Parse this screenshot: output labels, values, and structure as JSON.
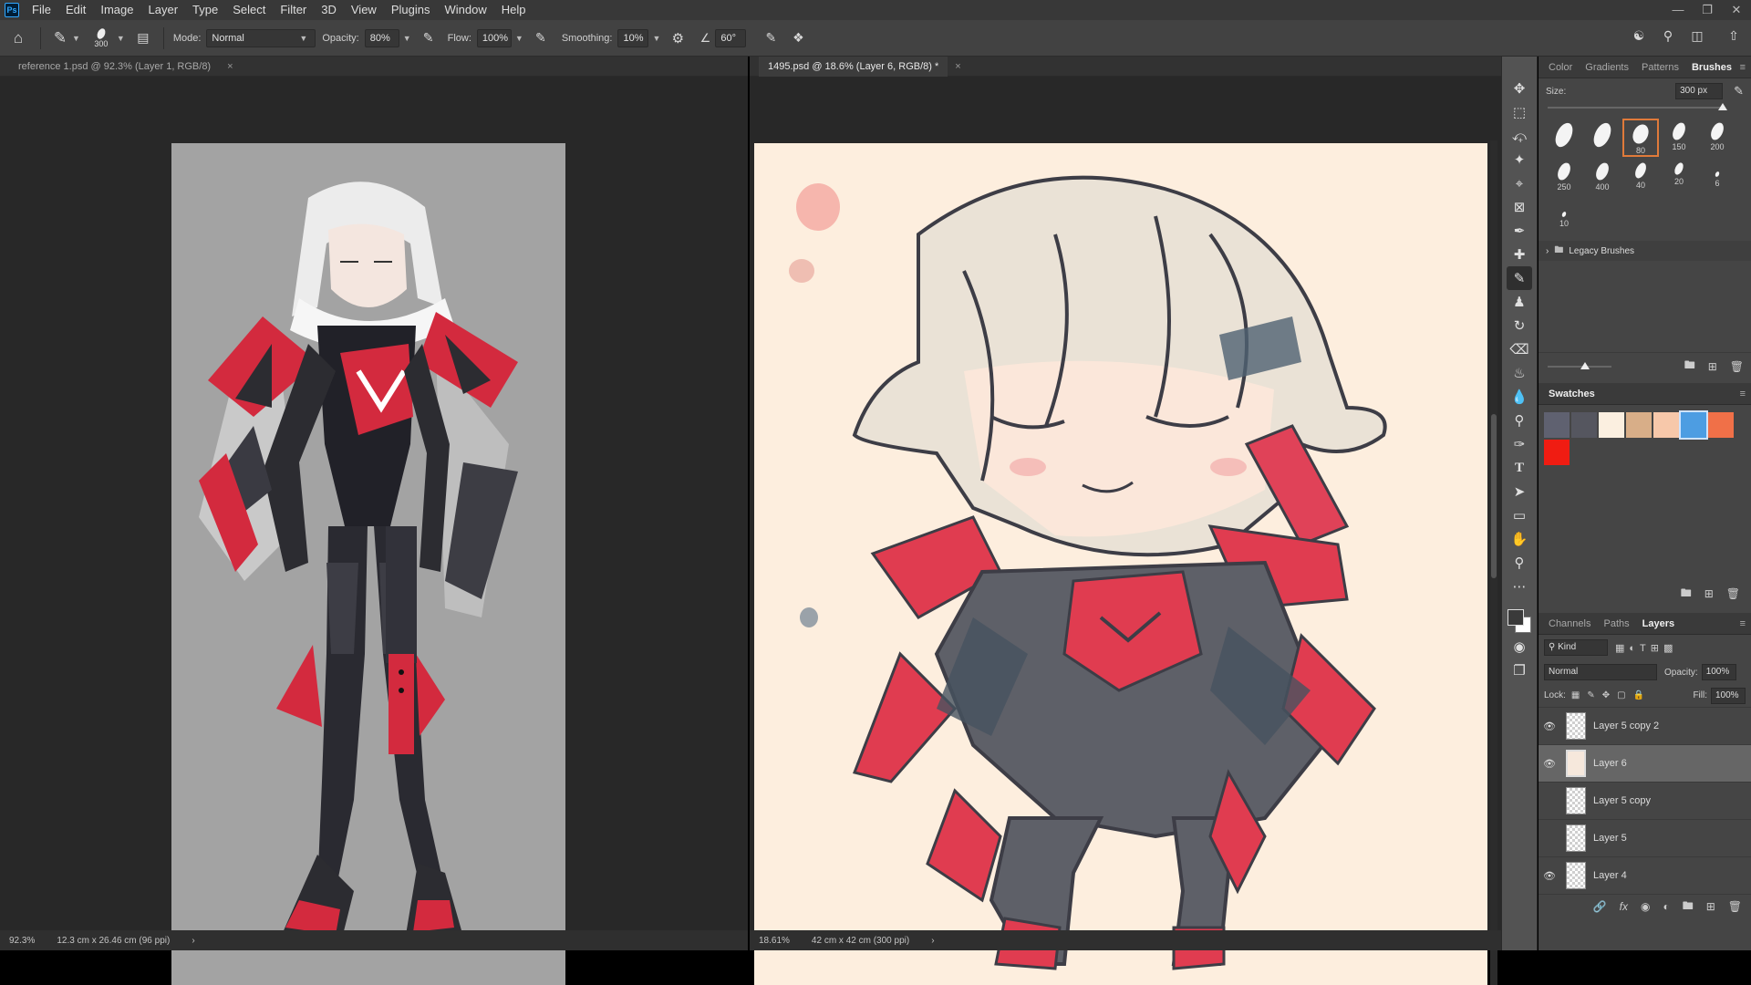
{
  "app": {
    "logo": "Ps"
  },
  "menu": [
    "File",
    "Edit",
    "Image",
    "Layer",
    "Type",
    "Select",
    "Filter",
    "3D",
    "View",
    "Plugins",
    "Window",
    "Help"
  ],
  "window_controls": [
    "minimize-icon",
    "restore-icon",
    "close-icon"
  ],
  "options_bar": {
    "brush_size": "300",
    "mode_label": "Mode:",
    "mode_value": "Normal",
    "opacity_label": "Opacity:",
    "opacity_value": "80%",
    "flow_label": "Flow:",
    "flow_value": "100%",
    "smoothing_label": "Smoothing:",
    "smoothing_value": "10%",
    "angle_value": "60°"
  },
  "documents": {
    "left": {
      "tab_title": "reference 1.psd @ 92.3% (Layer 1, RGB/8)",
      "zoom": "92.3%",
      "doc_size": "12.3 cm x 26.46 cm (96 ppi)"
    },
    "right": {
      "tab_title": "1495.psd @ 18.6% (Layer 6, RGB/8) *",
      "zoom": "18.61%",
      "doc_size": "42 cm x 42 cm (300 ppi)"
    }
  },
  "brushes_panel": {
    "tabs": [
      "Color",
      "Gradients",
      "Patterns",
      "Brushes"
    ],
    "active_tab": "Brushes",
    "size_label": "Size:",
    "size_value": "300 px",
    "presets": [
      "",
      "",
      "80",
      "150",
      "200",
      "250",
      "400",
      "40",
      "20",
      "6",
      "10"
    ],
    "folder_label": "Legacy Brushes"
  },
  "swatches_panel": {
    "title": "Swatches",
    "colors": [
      "#5f6170",
      "#55565f",
      "#fbefe0",
      "#d8ae88",
      "#f7c8aa",
      "#4d9de2",
      "#f07048",
      "#f01c12"
    ]
  },
  "layers_panel": {
    "tabs": [
      "Channels",
      "Paths",
      "Layers"
    ],
    "active_tab": "Layers",
    "filter_kind": "Kind",
    "blend_mode": "Normal",
    "opacity_label": "Opacity:",
    "opacity_value": "100%",
    "lock_label": "Lock:",
    "fill_label": "Fill:",
    "fill_value": "100%",
    "layers": [
      {
        "name": "Layer 5 copy 2",
        "visible": true,
        "selected": false
      },
      {
        "name": "Layer 6",
        "visible": true,
        "selected": true
      },
      {
        "name": "Layer 5 copy",
        "visible": false,
        "selected": false
      },
      {
        "name": "Layer 5",
        "visible": false,
        "selected": false
      },
      {
        "name": "Layer 4",
        "visible": true,
        "selected": false
      }
    ]
  }
}
